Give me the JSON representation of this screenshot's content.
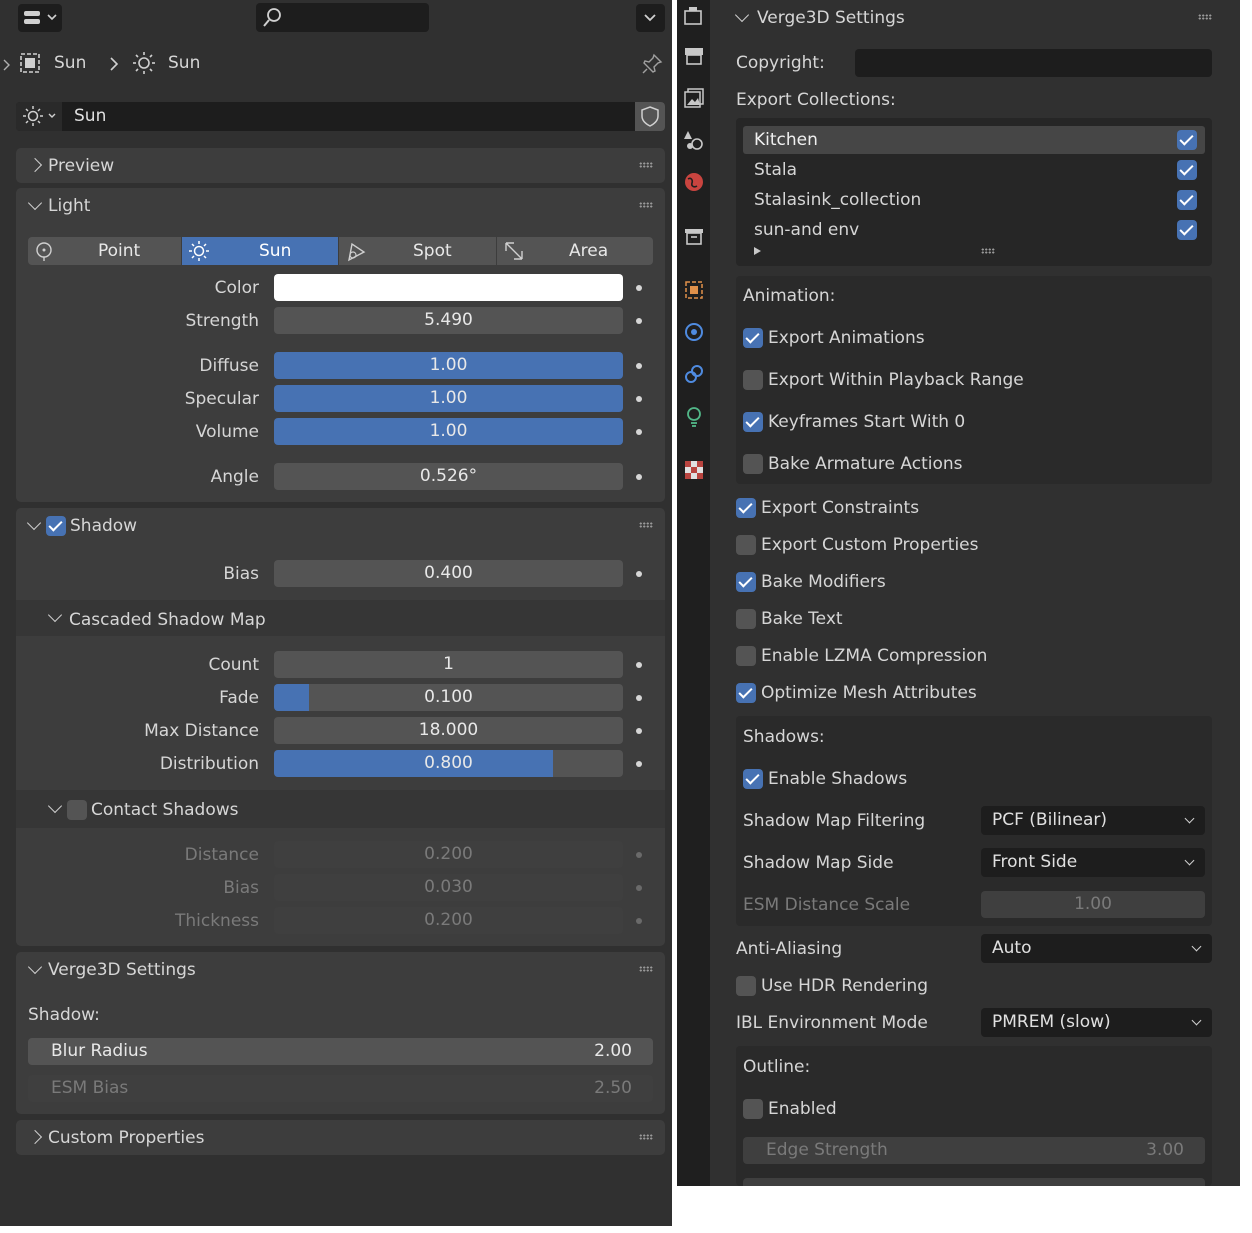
{
  "left": {
    "breadcrumb": {
      "object": "Sun",
      "light": "Sun"
    },
    "datablock": {
      "name": "Sun"
    },
    "sections": {
      "preview": "Preview",
      "light": "Light",
      "shadow": "Shadow",
      "csm": "Cascaded Shadow Map",
      "contact": "Contact Shadows",
      "verge": "Verge3D Settings",
      "custom": "Custom Properties"
    },
    "light_types": [
      "Point",
      "Sun",
      "Spot",
      "Area"
    ],
    "light_props": {
      "color_label": "Color",
      "strength_label": "Strength",
      "strength": "5.490",
      "diffuse_label": "Diffuse",
      "diffuse": "1.00",
      "specular_label": "Specular",
      "specular": "1.00",
      "volume_label": "Volume",
      "volume": "1.00",
      "angle_label": "Angle",
      "angle": "0.526°"
    },
    "shadow": {
      "enabled": true,
      "bias_label": "Bias",
      "bias": "0.400"
    },
    "csm": {
      "count_label": "Count",
      "count": "1",
      "fade_label": "Fade",
      "fade": "0.100",
      "fade_fraction": 0.1,
      "maxdist_label": "Max Distance",
      "maxdist": "18.000",
      "distribution_label": "Distribution",
      "distribution": "0.800",
      "distribution_fraction": 0.8
    },
    "contact": {
      "enabled": false,
      "distance_label": "Distance",
      "distance": "0.200",
      "bias_label": "Bias",
      "bias": "0.030",
      "thickness_label": "Thickness",
      "thickness": "0.200"
    },
    "verge": {
      "shadow_label": "Shadow:",
      "blur_label": "Blur Radius",
      "blur": "2.00",
      "esm_label": "ESM Bias",
      "esm": "2.50"
    }
  },
  "right": {
    "title": "Verge3D Settings",
    "copyright_label": "Copyright:",
    "copyright_value": "",
    "collections_label": "Export Collections:",
    "collections": [
      "Kitchen",
      "Stala",
      "Stalasink_collection",
      "sun-and env"
    ],
    "animation_label": "Animation:",
    "animation_opts": [
      "Export Animations",
      "Export Within Playback Range",
      "Keyframes Start With 0",
      "Bake Armature Actions"
    ],
    "export_opts": [
      "Export Constraints",
      "Export Custom Properties",
      "Bake Modifiers",
      "Bake Text",
      "Enable LZMA Compression",
      "Optimize Mesh Attributes"
    ],
    "shadows_label": "Shadows:",
    "enable_shadows": "Enable Shadows",
    "smf_label": "Shadow Map Filtering",
    "smf_value": "PCF (Bilinear)",
    "sms_label": "Shadow Map Side",
    "sms_value": "Front Side",
    "esm_label": "ESM Distance Scale",
    "esm_value": "1.00",
    "aa_label": "Anti-Aliasing",
    "aa_value": "Auto",
    "hdr_label": "Use HDR Rendering",
    "ibl_label": "IBL Environment Mode",
    "ibl_value": "PMREM (slow)",
    "outline_label": "Outline:",
    "outline_enabled": "Enabled",
    "edge_label": "Edge Strength",
    "edge_value": "3.00"
  },
  "colors": {
    "accent": "#4772b3",
    "panel": "#303030",
    "section": "#3d3d3d",
    "field": "#545454"
  }
}
